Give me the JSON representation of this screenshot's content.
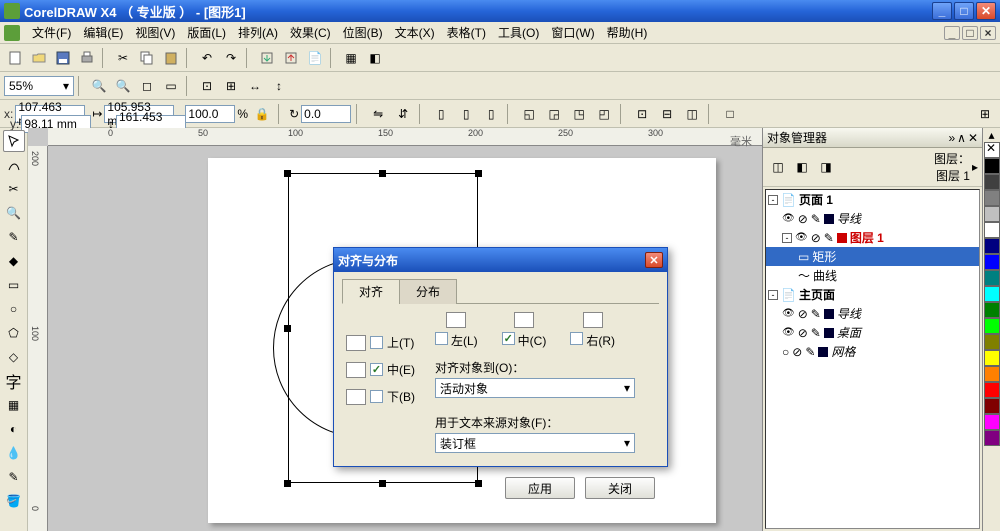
{
  "window": {
    "title": "CorelDRAW X4 （ 专业版 ） - [图形1]"
  },
  "menu": {
    "file": "文件(F)",
    "edit": "编辑(E)",
    "view": "视图(V)",
    "layout": "版面(L)",
    "arrange": "排列(A)",
    "effects": "效果(C)",
    "bitmaps": "位图(B)",
    "text": "文本(X)",
    "table": "表格(T)",
    "tools": "工具(O)",
    "window": "窗口(W)",
    "help": "帮助(H)"
  },
  "zoom": {
    "value": "55%"
  },
  "props": {
    "x": "107.463 mm",
    "y": "98.11 mm",
    "w": "105.953 mm",
    "h": "161.453 mm",
    "sx": "100.0",
    "sy": "100.0",
    "rot": "0.0"
  },
  "ruler_h": [
    "0",
    "50",
    "100",
    "150",
    "200",
    "250",
    "300"
  ],
  "ruler_v": [
    "200",
    "100",
    "0"
  ],
  "canvas_label": "毫米",
  "dialog": {
    "title": "对齐与分布",
    "tab_align": "对齐",
    "tab_dist": "分布",
    "left": "左(L)",
    "center_h": "中(C)",
    "right": "右(R)",
    "top": "上(T)",
    "center_v": "中(E)",
    "bottom": "下(B)",
    "align_to_lbl": "对齐对象到(O)：",
    "align_to_val": "活动对象",
    "text_src_lbl": "用于文本来源对象(F)：",
    "text_src_val": "装订框",
    "apply": "应用",
    "close": "关闭"
  },
  "dock": {
    "title": "对象管理器",
    "layer_lbl": "图层：",
    "layer_val": "图层 1",
    "page1": "页面 1",
    "guides": "导线",
    "layer1": "图层 1",
    "rect": "矩形",
    "curve": "曲线",
    "master": "主页面",
    "desktop": "桌面",
    "grid": "网格"
  },
  "palette": [
    "#000000",
    "#ffffff",
    "#808080",
    "#c0c0c0",
    "#008080",
    "#000080",
    "#ff00ff",
    "#ff0000",
    "#ffff00",
    "#008000",
    "#00ff00",
    "#0000ff",
    "#800080",
    "#808000",
    "#ff8000",
    "#8b4513"
  ]
}
